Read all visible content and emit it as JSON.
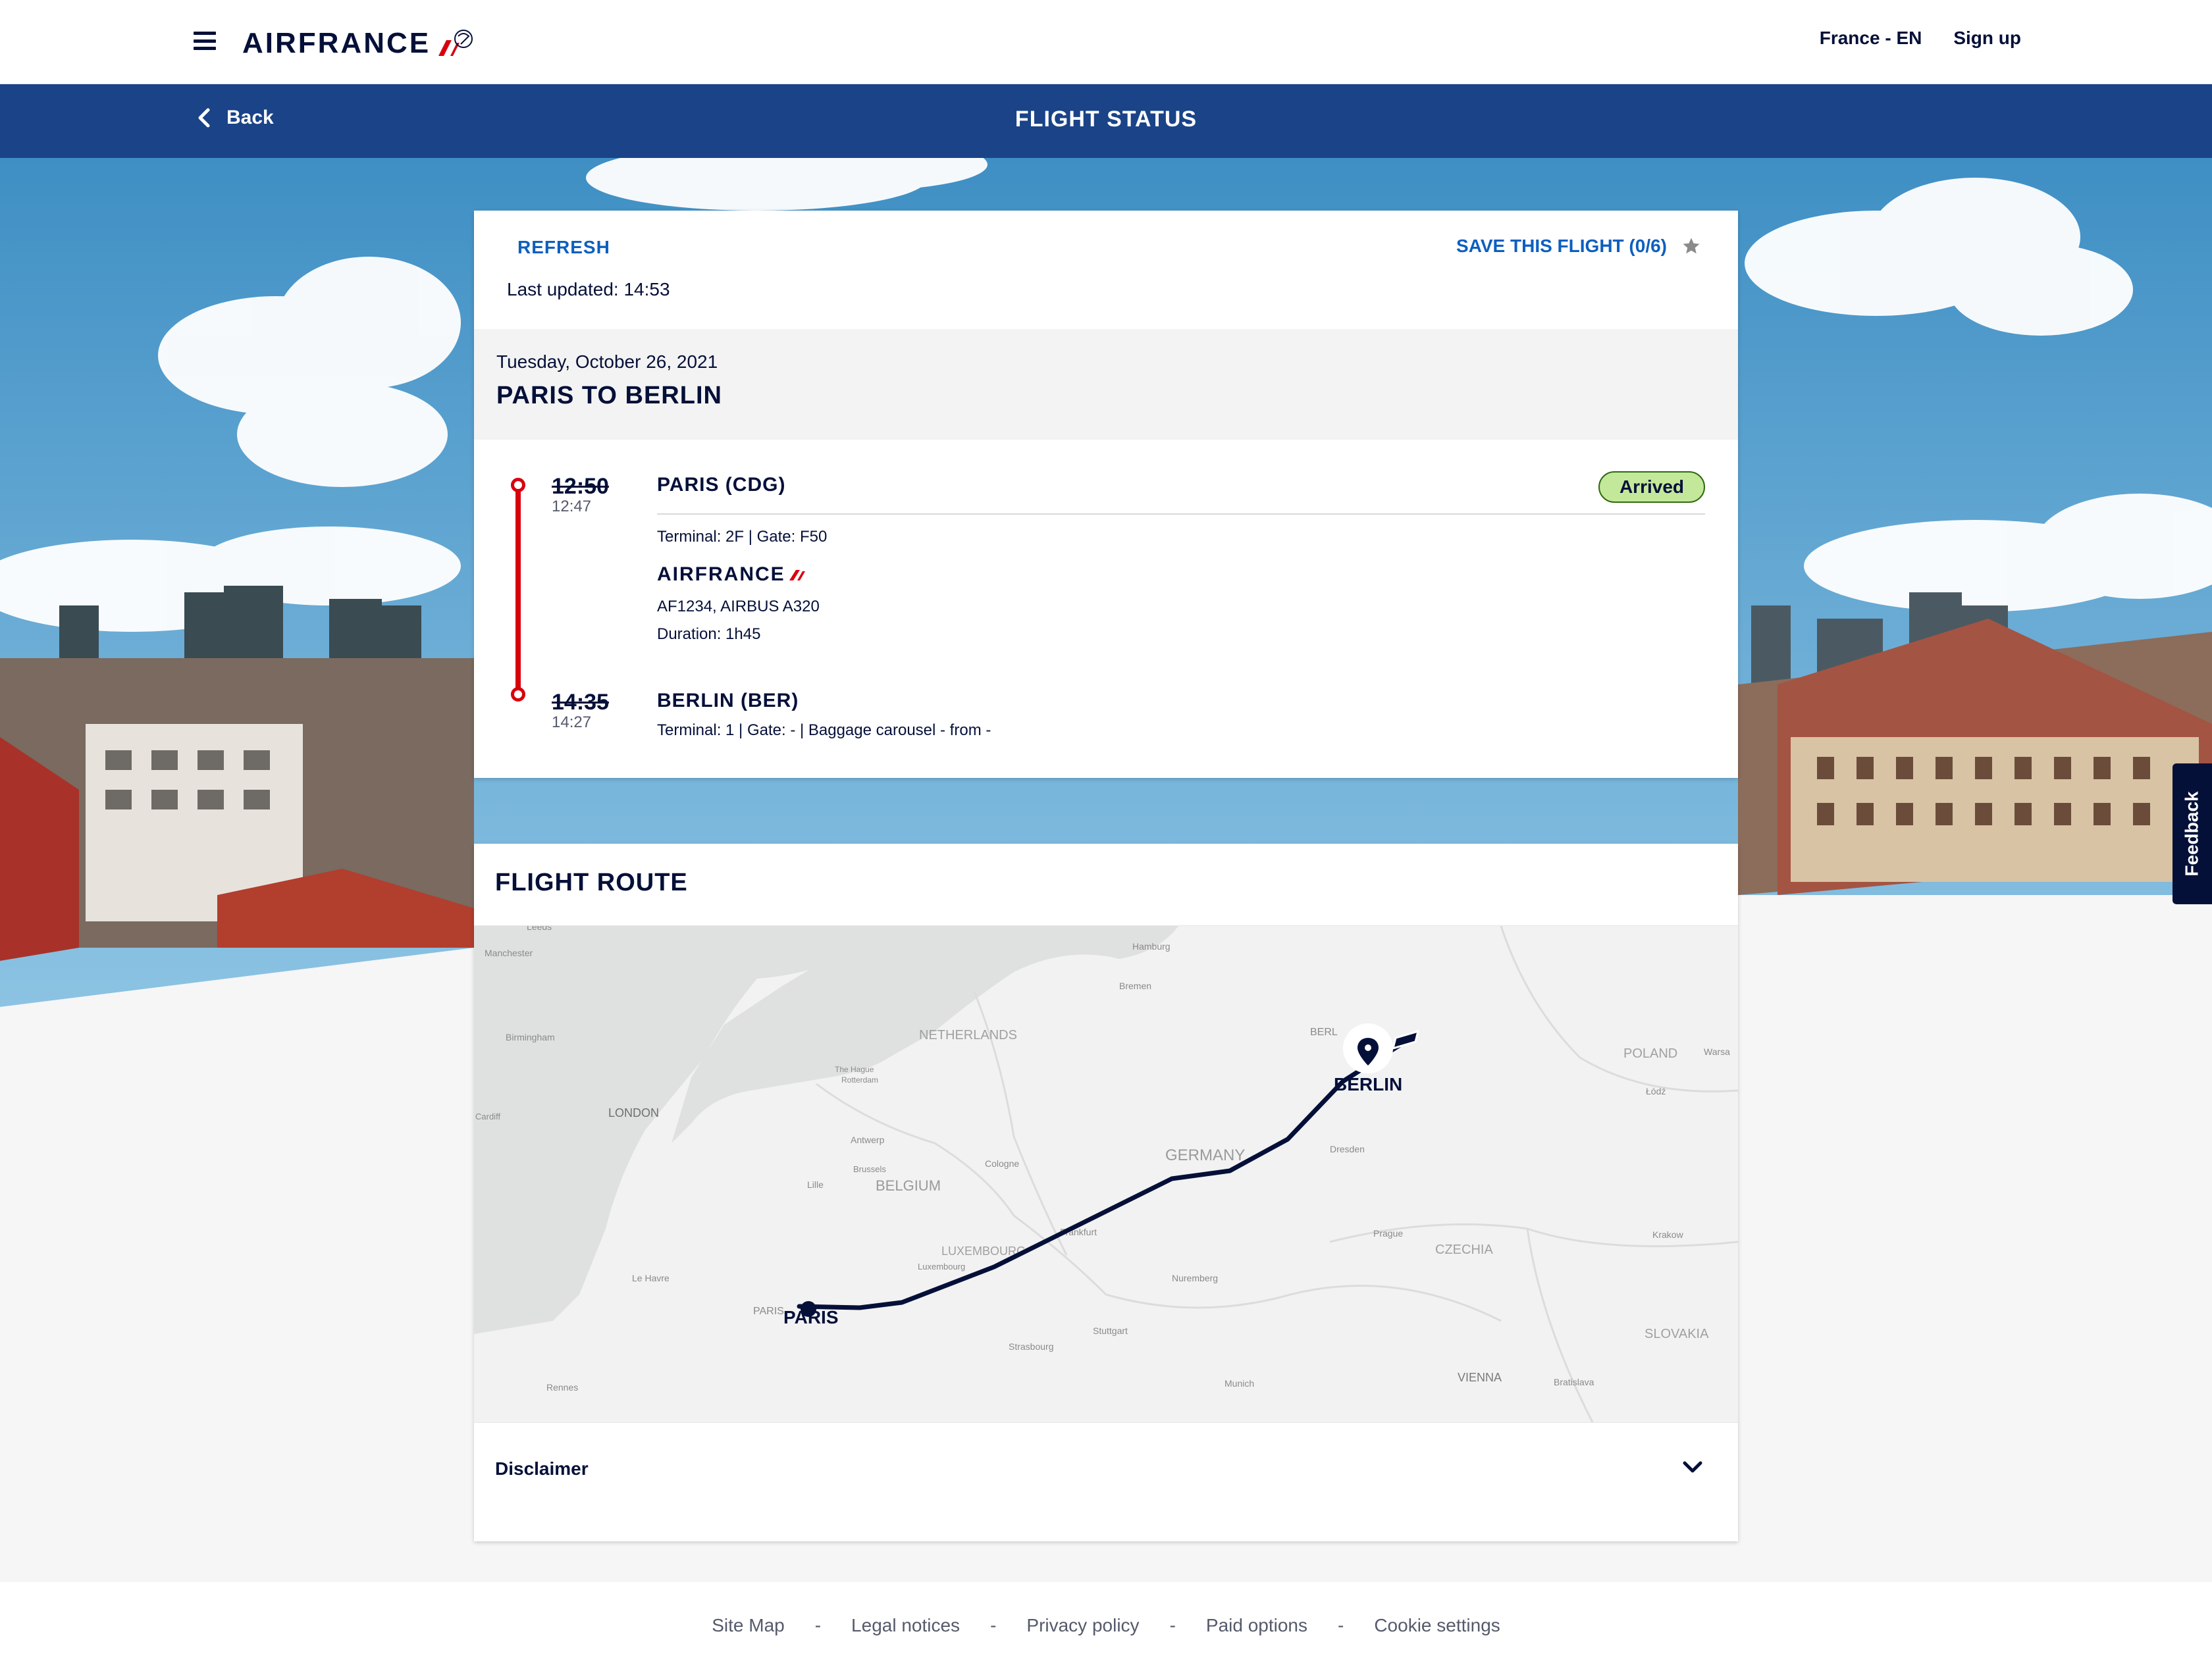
{
  "header": {
    "logo_text": "AIRFRANCE",
    "locale": "France - EN",
    "signup": "Sign up"
  },
  "nav": {
    "back": "Back",
    "title": "FLIGHT STATUS"
  },
  "status": {
    "refresh": "REFRESH",
    "last_updated": "Last updated: 14:53",
    "save": "SAVE THIS FLIGHT (0/6)",
    "date": "Tuesday, October 26, 2021",
    "route_title": "PARIS TO BERLIN",
    "departure": {
      "scheduled": "12:50",
      "actual": "12:47",
      "city": "PARIS (CDG)",
      "terminal": "Terminal: 2F | Gate: F50"
    },
    "badge": "Arrived",
    "airline_logo": "AIRFRANCE",
    "flight": "AF1234, AIRBUS A320",
    "duration": "Duration: 1h45",
    "arrival": {
      "scheduled": "14:35",
      "actual": "14:27",
      "city": "BERLIN (BER)",
      "terminal": "Terminal: 1 | Gate: - | Baggage carousel - from -"
    }
  },
  "route": {
    "title": "FLIGHT ROUTE",
    "origin_label": "PARIS",
    "destination_label": "BERLIN",
    "map_labels": [
      "Leeds",
      "Manchester",
      "Hamburg",
      "Bremen",
      "Birmingham",
      "NETHERLANDS",
      "The Hague",
      "Rotterdam",
      "POLAND",
      "Warsa",
      "Łódź",
      "LONDON",
      "Cardiff",
      "Antwerp",
      "Brussels",
      "BELGIUM",
      "Cologne",
      "GERMANY",
      "Dresden",
      "Lille",
      "Frankfurt",
      "LUXEMBOURG",
      "Luxembourg",
      "Prague",
      "CZECHIA",
      "Krakow",
      "Le Havre",
      "Nuremberg",
      "Stuttgart",
      "Strasbourg",
      "Rennes",
      "Munich",
      "VIENNA",
      "Bratislava",
      "SLOVAKIA",
      "BERL",
      "PARIS"
    ],
    "disclaimer": "Disclaimer"
  },
  "feedback": "Feedback",
  "footer": {
    "links": [
      "Site Map",
      "Legal notices",
      "Privacy policy",
      "Paid options",
      "Cookie settings"
    ],
    "separator": "-"
  },
  "colors": {
    "brand_navy": "#051039",
    "nav_blue": "#1a4388",
    "link_blue": "#0d5fbf",
    "timeline_red": "#d8000d",
    "arrived_green": "#c4e89a"
  }
}
